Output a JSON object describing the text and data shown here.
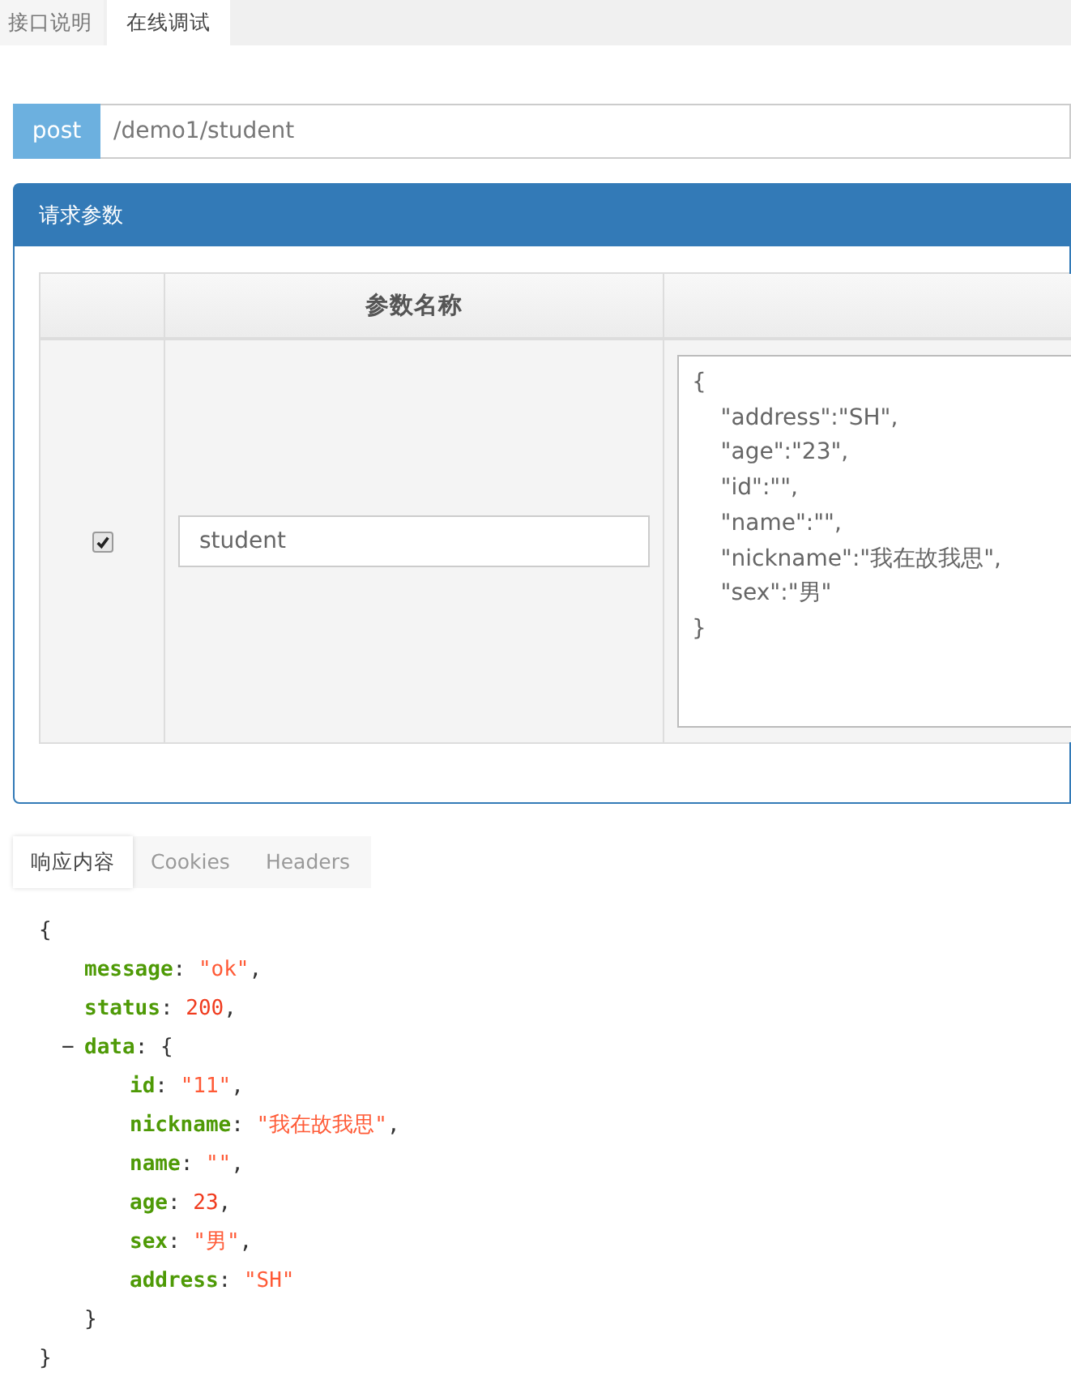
{
  "tabs": [
    {
      "label": "接口说明",
      "selected": false
    },
    {
      "label": "在线调试",
      "selected": true
    }
  ],
  "request": {
    "method": "post",
    "url": "/demo1/student"
  },
  "params_panel": {
    "title": "请求参数",
    "column_2_header": "参数名称",
    "rows": [
      {
        "checked": true,
        "name": "student",
        "value": "{\n    \"address\":\"SH\",\n    \"age\":\"23\",\n    \"id\":\"\",\n    \"name\":\"\",\n    \"nickname\":\"我在故我思\",\n    \"sex\":\"男\"\n}"
      }
    ]
  },
  "response_tabs": [
    {
      "label": "响应内容",
      "selected": true
    },
    {
      "label": "Cookies",
      "selected": false
    },
    {
      "label": "Headers",
      "selected": false
    }
  ],
  "response": {
    "open": "{",
    "close": "}",
    "fields": [
      {
        "key": "message",
        "colon": ":",
        "value": "\"ok\"",
        "kind": "string",
        "comma": ","
      },
      {
        "key": "status",
        "colon": ":",
        "value": "200",
        "kind": "number",
        "comma": ","
      },
      {
        "key": "data",
        "colon": ":",
        "toggle": "−",
        "expanded": true,
        "open": "{",
        "close": "}",
        "children": [
          {
            "key": "id",
            "colon": ":",
            "value": "\"11\"",
            "kind": "string",
            "comma": ","
          },
          {
            "key": "nickname",
            "colon": ":",
            "value": "\"我在故我思\"",
            "kind": "string",
            "comma": ","
          },
          {
            "key": "name",
            "colon": ":",
            "value": "\"\"",
            "kind": "string",
            "comma": ","
          },
          {
            "key": "age",
            "colon": ":",
            "value": "23",
            "kind": "number",
            "comma": ","
          },
          {
            "key": "sex",
            "colon": ":",
            "value": "\"男\"",
            "kind": "string",
            "comma": ","
          },
          {
            "key": "address",
            "colon": ":",
            "value": "\"SH\"",
            "kind": "string"
          }
        ]
      }
    ]
  }
}
